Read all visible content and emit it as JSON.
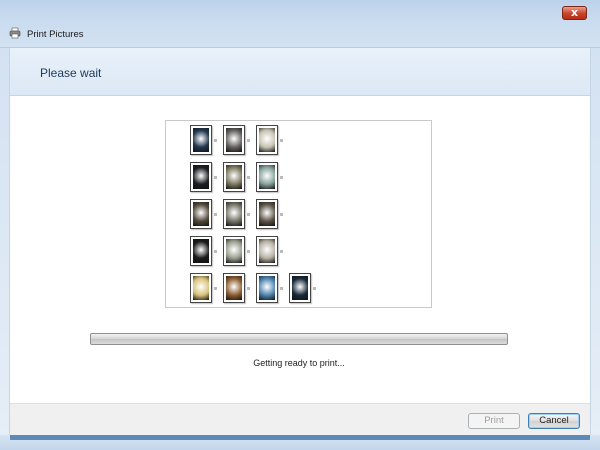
{
  "window": {
    "title": "Print Pictures",
    "close_symbol": "x"
  },
  "header": {
    "heading": "Please wait"
  },
  "icons": {
    "app": "printer-icon",
    "close": "close-icon"
  },
  "preview": {
    "thumbnail_rows": [
      {
        "thumbs": [
          {
            "color": "#22384f"
          },
          {
            "color": "#676161"
          },
          {
            "color": "#c7c3b2"
          }
        ]
      },
      {
        "thumbs": [
          {
            "color": "#1b1e22"
          },
          {
            "color": "#7f7a62"
          },
          {
            "color": "#88a39c"
          }
        ]
      },
      {
        "thumbs": [
          {
            "color": "#544b3c"
          },
          {
            "color": "#77766a"
          },
          {
            "color": "#5e5548"
          }
        ]
      },
      {
        "thumbs": [
          {
            "color": "#1a1a1a"
          },
          {
            "color": "#98a08f"
          },
          {
            "color": "#b6b0a3"
          }
        ]
      },
      {
        "thumbs": [
          {
            "color": "#d8c27a"
          },
          {
            "color": "#8d5e31"
          },
          {
            "color": "#4f85b1"
          },
          {
            "color": "#182a3c"
          }
        ]
      }
    ]
  },
  "progress": {
    "value": 0
  },
  "status": {
    "text": "Getting ready to print..."
  },
  "buttons": {
    "print_label": "Print",
    "cancel_label": "Cancel"
  }
}
